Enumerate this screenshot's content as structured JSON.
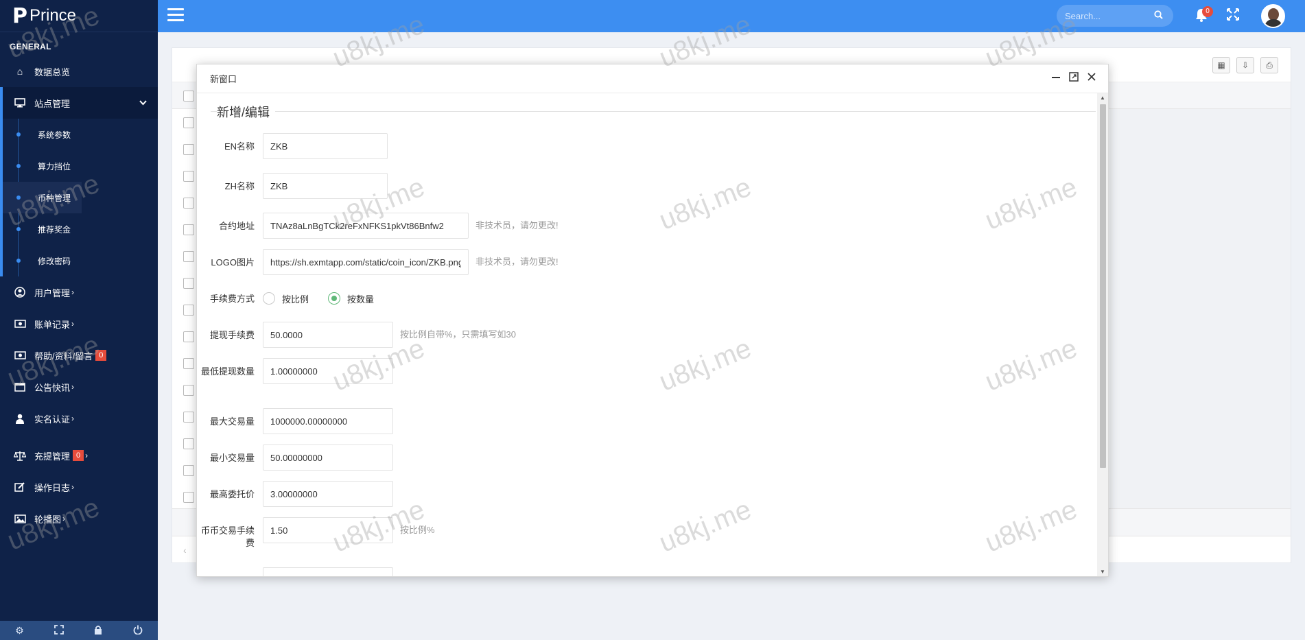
{
  "sidebar": {
    "logo_mark": "P",
    "logo_text": "Prince",
    "section": "GENERAL",
    "items": [
      {
        "label": "数据总览"
      },
      {
        "label": "站点管理"
      },
      {
        "label": "用户管理"
      },
      {
        "label": "账单记录"
      },
      {
        "label": "帮助/资料/留言",
        "badge": "0"
      },
      {
        "label": "公告快讯"
      },
      {
        "label": "实名认证"
      },
      {
        "label": "充提管理",
        "badge": "0"
      },
      {
        "label": "操作日志"
      },
      {
        "label": "轮播图"
      }
    ],
    "subitems": [
      {
        "label": "系统参数"
      },
      {
        "label": "算力挡位"
      },
      {
        "label": "币种管理"
      },
      {
        "label": "推荐奖金"
      },
      {
        "label": "修改密码"
      }
    ],
    "arrow": "›",
    "chevron": "⌄",
    "footer_icons": [
      "gear-icon",
      "fullscreen-icon",
      "lock-icon",
      "power-icon"
    ]
  },
  "header": {
    "search_placeholder": "Search...",
    "notification_count": "0",
    "icons": [
      "menu-icon",
      "search-icon",
      "bell-icon",
      "fullscreen-icon",
      "avatar"
    ]
  },
  "modal": {
    "title": "新窗口",
    "fieldset_title": "新增/编辑",
    "fields": {
      "en_name": {
        "label": "EN名称",
        "value": "ZKB"
      },
      "zh_name": {
        "label": "ZH名称",
        "value": "ZKB"
      },
      "contract": {
        "label": "合约地址",
        "value": "TNAz8aLnBgTCk2reFxNFKS1pkVt86Bnfw2",
        "hint": "非技术员，请勿更改!"
      },
      "logo": {
        "label": "LOGO图片",
        "value": "https://sh.exmtapp.com/static/coin_icon/ZKB.png",
        "hint": "非技术员，请勿更改!"
      },
      "fee_mode": {
        "label": "手续费方式",
        "option1": "按比例",
        "option2": "按数量",
        "selected": "按数量"
      },
      "withdraw_fee": {
        "label": "提现手续费",
        "value": "50.0000",
        "hint": "按比例自带%，只需填写如30"
      },
      "min_withdraw": {
        "label": "最低提现数量",
        "value": "1.00000000"
      },
      "max_trade": {
        "label": "最大交易量",
        "value": "1000000.00000000"
      },
      "min_trade": {
        "label": "最小交易量",
        "value": "50.00000000"
      },
      "max_order_price": {
        "label": "最高委托价",
        "value": "3.00000000"
      },
      "trade_fee": {
        "label": "币币交易手续费",
        "value": "1.50",
        "hint": "按比例%"
      }
    }
  },
  "watermark": "u8kj.me",
  "colors": {
    "sidebar_bg": "#0f2248",
    "header_bg": "#3d8ef1",
    "accent": "#3a8cf0",
    "badge": "#e74c3c",
    "radio_checked": "#5fb878"
  }
}
